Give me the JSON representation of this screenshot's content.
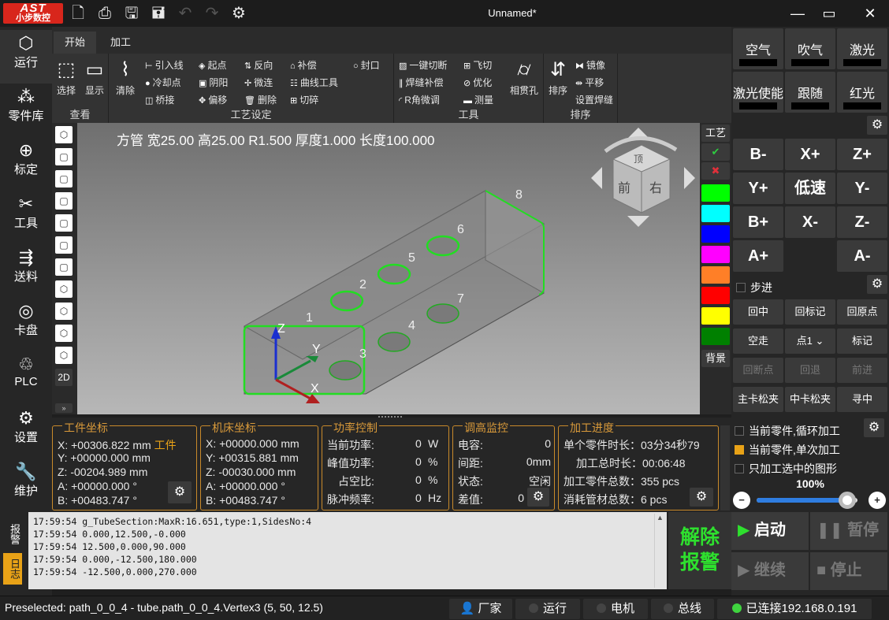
{
  "app": {
    "logo_main": "AST",
    "logo_sub": "小步数控",
    "title": "Unnamed*"
  },
  "toolbar_icons": [
    "new-file-icon",
    "print-icon",
    "save-icon",
    "save-as-icon",
    "undo-icon",
    "redo-icon",
    "gear-icon"
  ],
  "sidebar": [
    {
      "label": "运行",
      "icon": "cube-icon"
    },
    {
      "label": "零件库",
      "icon": "grid-icon"
    },
    {
      "label": "标定",
      "icon": "crosshair-icon"
    },
    {
      "label": "工具",
      "icon": "tools-icon"
    },
    {
      "label": "送料",
      "icon": "feed-icon"
    },
    {
      "label": "卡盘",
      "icon": "chuck-icon"
    },
    {
      "label": "PLC",
      "icon": "plc-icon"
    },
    {
      "label": "设置",
      "icon": "gear-icon"
    },
    {
      "label": "维护",
      "icon": "wrench-icon"
    }
  ],
  "ribbon": {
    "tabs": [
      "开始",
      "加工"
    ],
    "groups": {
      "view": {
        "title": "查看",
        "select": "选择",
        "display": "显示"
      },
      "process": {
        "title": "工艺设定",
        "clear": "清除",
        "items": [
          "引入线",
          "起点",
          "反向",
          "补偿",
          "封口",
          "冷却点",
          "阴阳",
          "微连",
          "曲线工具",
          "桥接",
          "偏移",
          "删除",
          "切碎"
        ]
      },
      "tools": {
        "title": "工具",
        "items": [
          "一键切断",
          "飞切",
          "焊缝补偿",
          "优化",
          "R角微调",
          "测量"
        ],
        "big": "相贯孔"
      },
      "sort": {
        "title": "排序",
        "big": "排序",
        "items": [
          "镜像",
          "平移",
          "设置焊缝"
        ]
      }
    }
  },
  "viewport": {
    "tube_info": "方管 宽25.00 高25.00 R1.500 厚度1.000 长度100.000",
    "labels": [
      "1",
      "2",
      "3",
      "4",
      "5",
      "6",
      "7",
      "8"
    ],
    "axes": [
      "X",
      "Y",
      "Z"
    ],
    "cube_faces": [
      "前",
      "右",
      "顶"
    ],
    "left_tools": [
      "iso-view",
      "front-view",
      "back-view",
      "left-view",
      "right-view",
      "top-view",
      "bottom-view",
      "iso-sw",
      "iso-ne",
      "iso-nw",
      "iso-se",
      "2D"
    ],
    "left_2d": "2D",
    "right_top": "工艺",
    "right_bottom": "背景",
    "layer_colors": [
      "#00ff00",
      "#00ffff",
      "#0000ff",
      "#ff00ff",
      "#ff7f27",
      "#ff0000",
      "#ffff00",
      "#008000"
    ]
  },
  "right_panel": {
    "io_buttons": [
      {
        "label": "空气"
      },
      {
        "label": "吹气"
      },
      {
        "label": "激光"
      },
      {
        "label": "激光使能"
      },
      {
        "label": "跟随"
      },
      {
        "label": "红光"
      }
    ],
    "jog": [
      "B-",
      "X+",
      "Z+",
      "Y+",
      "低速",
      "Y-",
      "B+",
      "X-",
      "Z-",
      "A+",
      "",
      "A-"
    ],
    "step_label": "步进",
    "sys_buttons": [
      "回中",
      "回标记",
      "回原点",
      "空走",
      "点1",
      "标记",
      "回断点",
      "回退",
      "前进",
      "主卡松夹",
      "中卡松夹",
      "寻中"
    ],
    "modes": [
      {
        "label": "当前零件,循环加工",
        "checked": false
      },
      {
        "label": "当前零件,单次加工",
        "checked": true
      },
      {
        "label": "只加工选中的图形",
        "checked": false
      }
    ],
    "speed_percent": "100%",
    "speed_fraction": 0.9,
    "run": {
      "start": "启动",
      "pause": "暂停",
      "resume": "继续",
      "stop": "停止"
    }
  },
  "panels": {
    "work_coords": {
      "title": "工件坐标",
      "x": "X: +00306.822 mm",
      "tag": "工件",
      "y": "Y: +00000.000 mm",
      "z": "Z:  -00204.989 mm",
      "a": "A: +00000.000 °",
      "b": "B: +00483.747 °"
    },
    "machine_coords": {
      "title": "机床坐标",
      "x": "X: +00000.000 mm",
      "y": "Y: +00315.881 mm",
      "z": "Z:  -00030.000 mm",
      "a": "A: +00000.000 °",
      "b": "B: +00483.747 °"
    },
    "power": {
      "title": "功率控制",
      "rows": [
        [
          "当前功率:",
          "0",
          "W"
        ],
        [
          "峰值功率:",
          "0",
          "%"
        ],
        [
          "占空比:",
          "0",
          "%"
        ],
        [
          "脉冲频率:",
          "0",
          "Hz"
        ]
      ]
    },
    "height": {
      "title": "调高监控",
      "rows": [
        [
          "电容:",
          "0"
        ],
        [
          "间距:",
          "0mm"
        ],
        [
          "状态:",
          "空闲"
        ],
        [
          "差值:",
          "0"
        ]
      ]
    },
    "progress": {
      "title": "加工进度",
      "rows": [
        "单个零件时长：03分34秒79",
        "加工总时长：00:06:48",
        "加工零件总数：355 pcs",
        "消耗管材总数：6 pcs"
      ]
    }
  },
  "log": {
    "tabs": [
      "报警",
      "日志"
    ],
    "lines": [
      "17:59:54 g_TubeSection:MaxR:16.651,type:1,SidesNo:4",
      "17:59:54 0.000,12.500,-0.000",
      "17:59:54 12.500,0.000,90.000",
      "17:59:54 0.000,-12.500,180.000",
      "17:59:54 -12.500,0.000,270.000"
    ],
    "alarm_button": [
      "解除",
      "报警"
    ]
  },
  "status": {
    "text": "Preselected: path_0_0_4 - tube.path_0_0_4.Vertex3 (5, 50, 12.5)",
    "vendor": "厂家",
    "run": "运行",
    "motor": "电机",
    "bus": "总线",
    "connection": "已连接192.168.0.191"
  }
}
